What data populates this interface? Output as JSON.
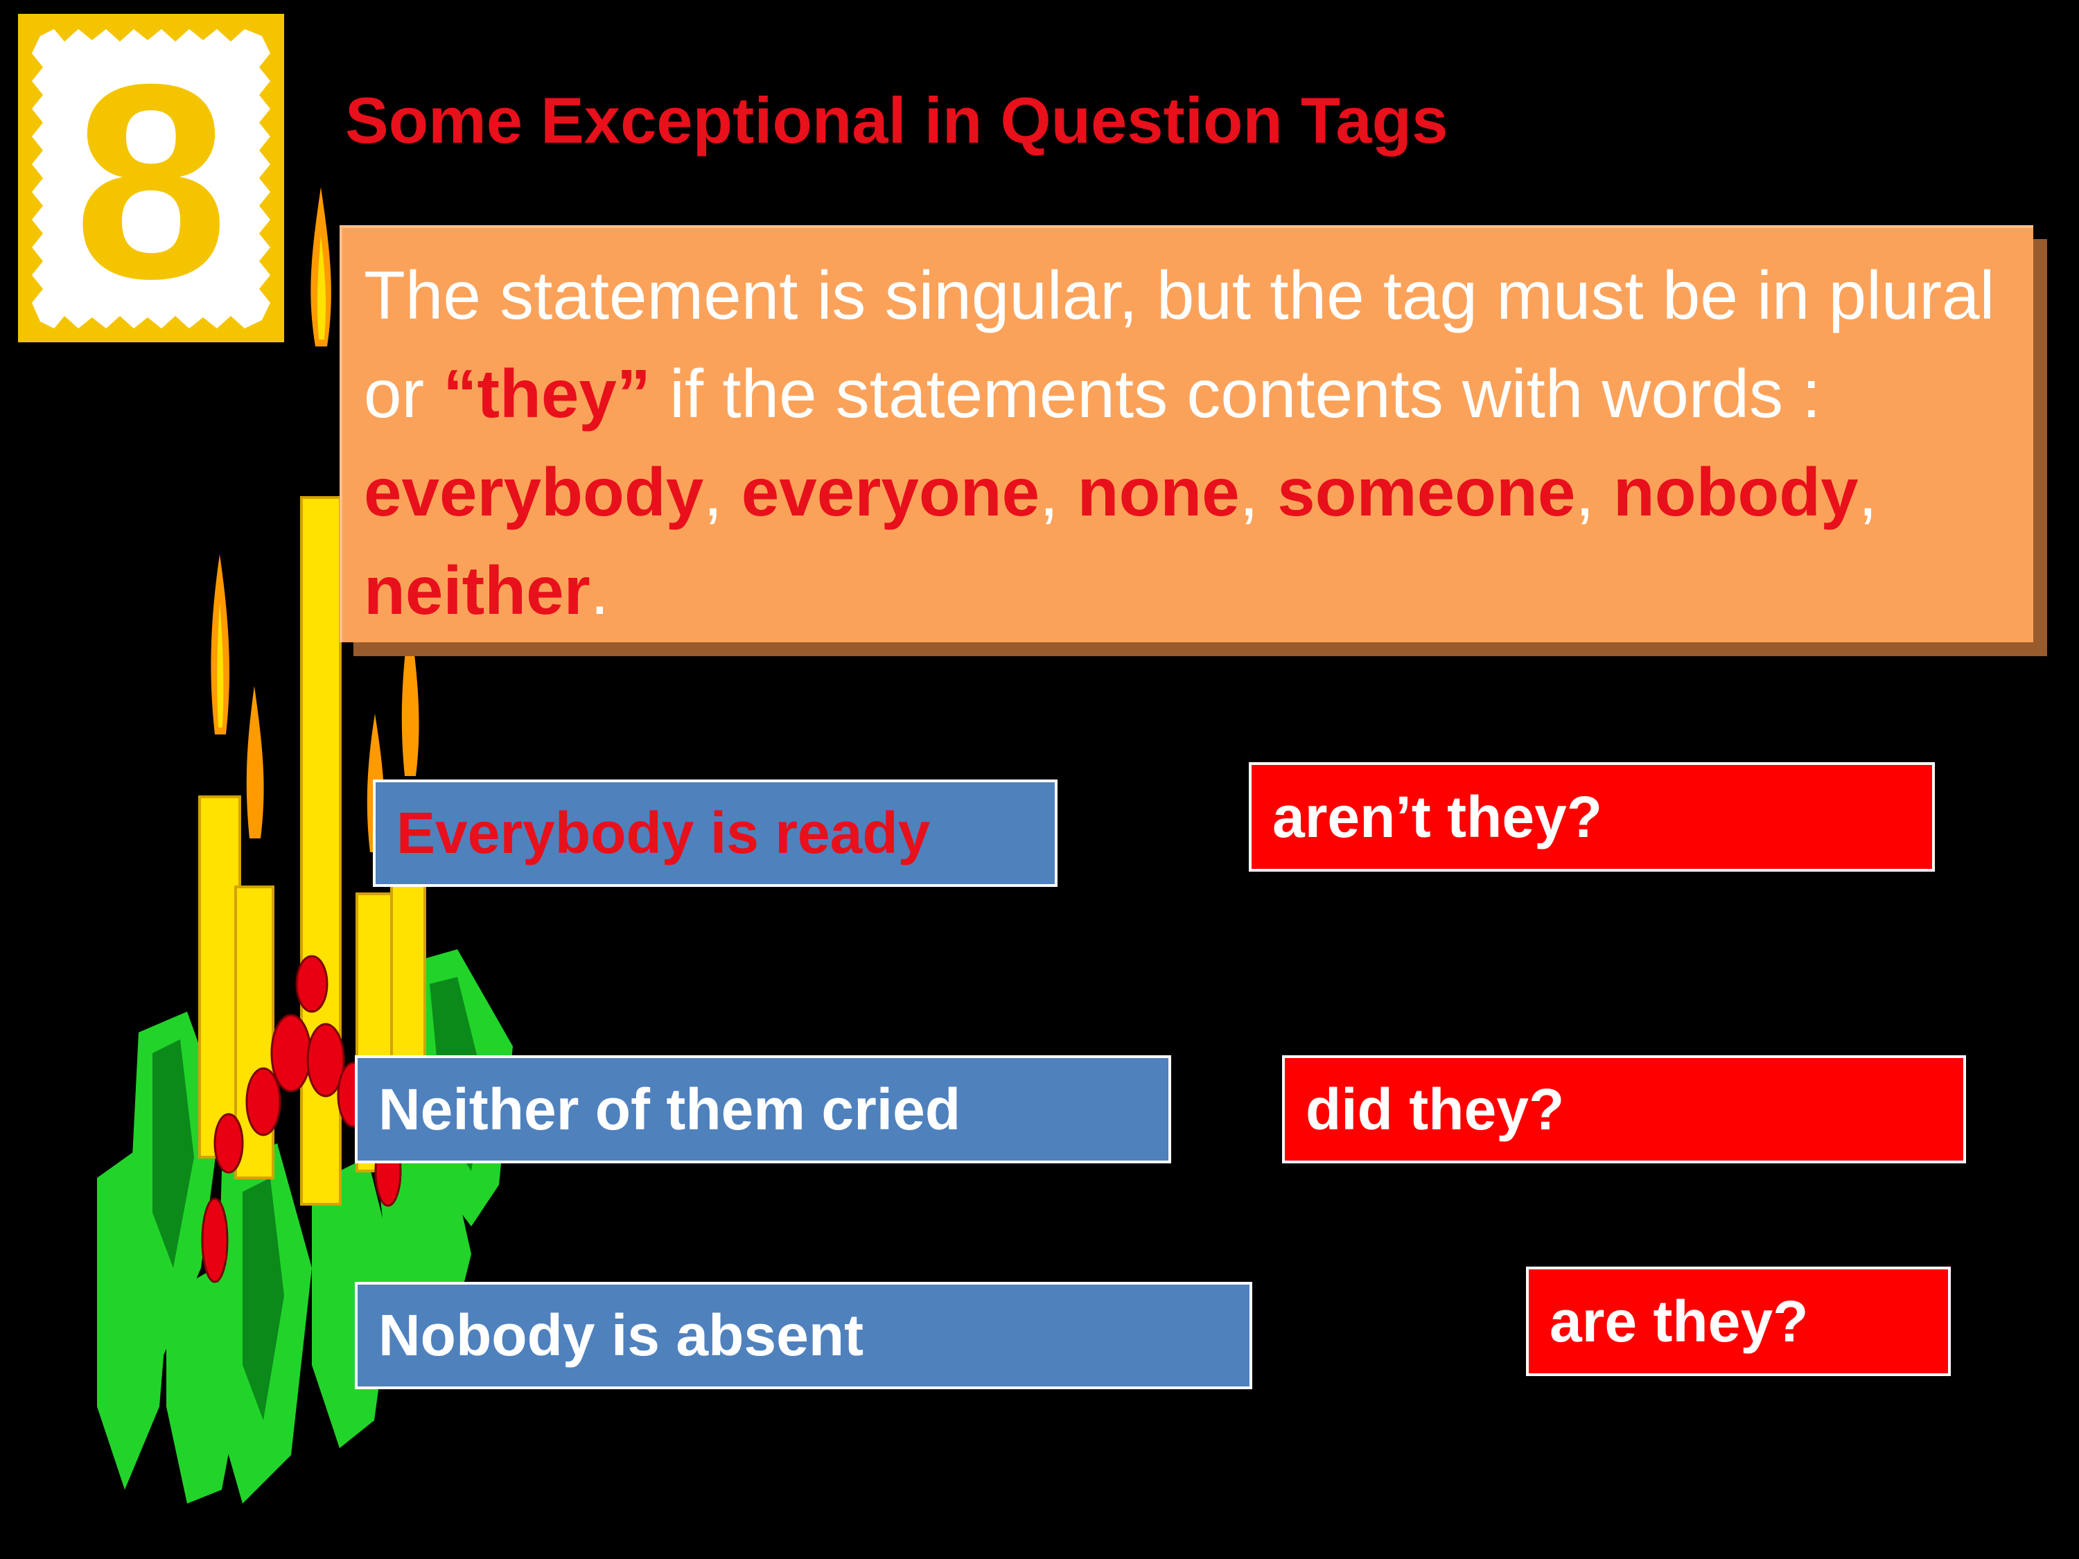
{
  "badge": {
    "number": "8"
  },
  "title": "Some Exceptional  in Question  Tags",
  "info": {
    "line_pre": "The statement is singular, but the tag must be in plural or ",
    "they_word": "“they”",
    "line_post": " if the statements contents with words :",
    "words": [
      "everybody",
      "everyone",
      "none",
      "someone",
      "nobody",
      "neither"
    ],
    "separators": [
      ",  ",
      ", ",
      ", ",
      ",  ",
      ", ",
      "."
    ]
  },
  "examples": [
    {
      "statement": "Everybody is ready",
      "tag": "aren’t they?"
    },
    {
      "statement": "Neither of them cried",
      "tag": "did they?"
    },
    {
      "statement": "Nobody is absent",
      "tag": "are they?"
    }
  ],
  "colors": {
    "background": "#000000",
    "title_red": "#e8101b",
    "info_box": "#fba25a",
    "statement_box": "#4f81bd",
    "tag_box": "#ff0000",
    "badge_yellow": "#f5c400"
  }
}
